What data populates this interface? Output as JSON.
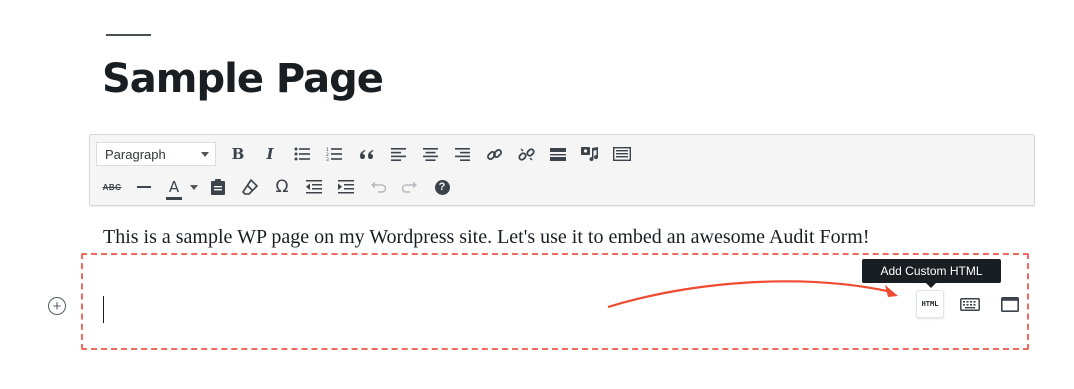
{
  "page": {
    "title": "Sample Page"
  },
  "toolbar": {
    "format_value": "Paragraph",
    "row1": [
      "bold",
      "italic",
      "bullet-list",
      "numbered-list",
      "blockquote",
      "align-left",
      "align-center",
      "align-right",
      "insert-link",
      "remove-link",
      "read-more",
      "insert-media",
      "toolbar-toggle"
    ],
    "row2": [
      "strikethrough",
      "horizontal-line",
      "text-color",
      "paste-as-text",
      "clear-formatting",
      "special-character",
      "decrease-indent",
      "increase-indent",
      "undo",
      "redo",
      "help"
    ],
    "bold_glyph": "B",
    "italic_glyph": "I",
    "strike_glyph": "ABC",
    "textcolor_glyph": "A",
    "omega_glyph": "Ω",
    "help_glyph": "?"
  },
  "content": {
    "paragraph": "This is a sample WP page on my Wordpress site. Let's use it to embed an awesome Audit Form!"
  },
  "block": {
    "tooltip": "Add Custom HTML",
    "html_button_label": "HTML",
    "inserter_glyph": "+",
    "border_color": "#f26a5e"
  },
  "annotation": {
    "arrow_color": "#f04a30"
  }
}
